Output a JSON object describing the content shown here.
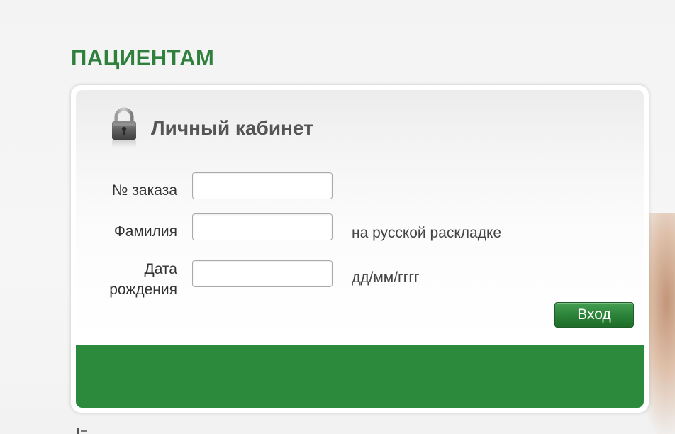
{
  "section": {
    "title": "ПАЦИЕНТАМ"
  },
  "login_panel": {
    "title": "Личный кабинет",
    "icon": "lock-icon",
    "fields": {
      "order_number": {
        "label": "№ заказа",
        "value": "",
        "placeholder": ""
      },
      "surname": {
        "label": "Фамилия",
        "value": "",
        "placeholder": "",
        "hint": "на русской раскладке"
      },
      "birth_date": {
        "label_line1": "Дата",
        "label_line2": "рождения",
        "value": "",
        "placeholder": "",
        "hint": "дд/мм/гггг"
      }
    },
    "submit_label": "Вход"
  },
  "colors": {
    "accent_green": "#2b8a3b",
    "title_green": "#2f7f3d",
    "panel_title_gray": "#555555"
  }
}
